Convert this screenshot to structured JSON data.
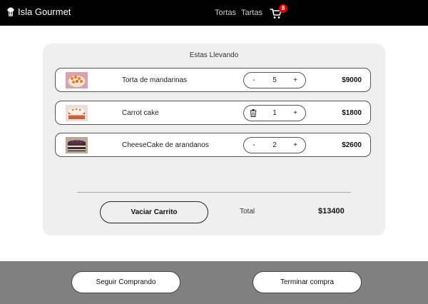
{
  "navbar": {
    "brand": "Isla Gourmet",
    "links": [
      "Tortas",
      "Tartas"
    ],
    "cart_count": "8"
  },
  "cart": {
    "title": "Estas Llevando",
    "items": [
      {
        "name": "Torta de mandarinas",
        "quantity": "5",
        "price": "$9000",
        "decrement_label": "-",
        "increment_label": "+"
      },
      {
        "name": "Carrot cake",
        "quantity": "1",
        "price": "$1800",
        "decrement_icon": "trash-icon",
        "increment_label": "+"
      },
      {
        "name": "CheeseCake de arandanos",
        "quantity": "2",
        "price": "$2600",
        "decrement_label": "-",
        "increment_label": "+"
      }
    ],
    "clear_label": "Vaciar Carrito",
    "total_label": "Total",
    "total_value": "$13400"
  },
  "footer": {
    "continue_label": "Seguir Comprando",
    "checkout_label": "Terminar compra"
  },
  "colors": {
    "navbar": "#000000",
    "card": "#efefef",
    "footer": "#808080",
    "badge": "#e00000"
  }
}
